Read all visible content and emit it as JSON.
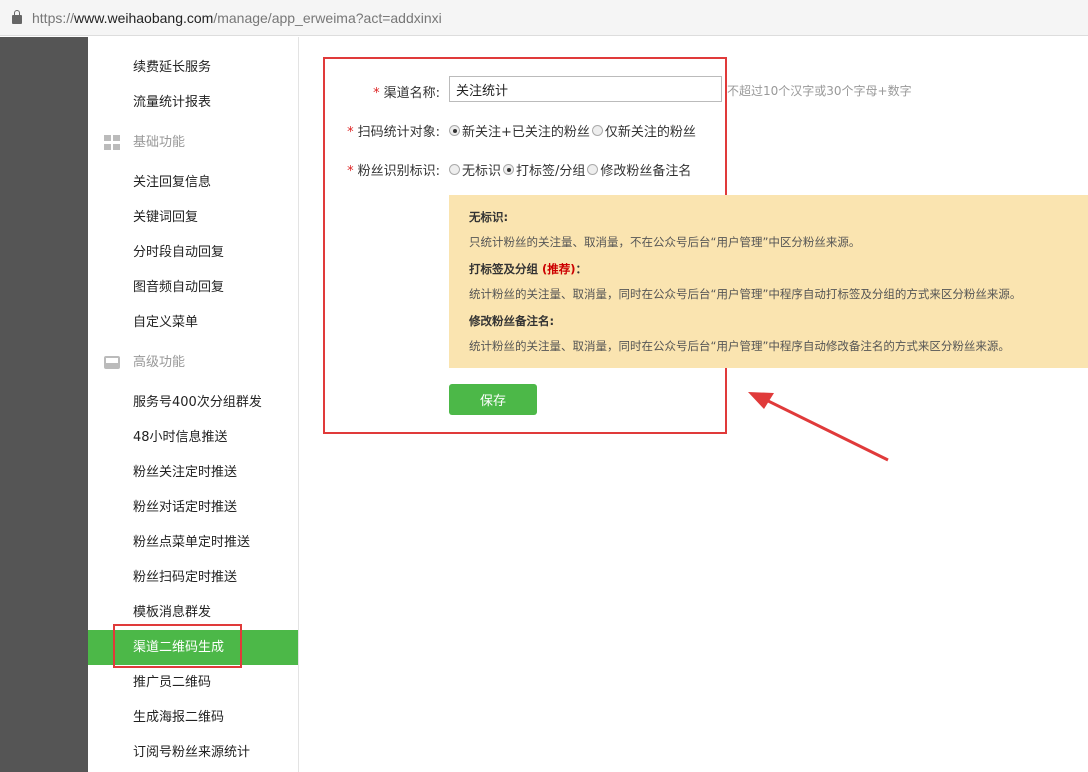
{
  "browser": {
    "url_scheme": "https://",
    "url_host": "www.weihaobang.com",
    "url_path": "/manage/app_erweima?act=addxinxi"
  },
  "sidebar": {
    "items": [
      {
        "label": "续费延长服务",
        "type": "item"
      },
      {
        "label": "流量统计报表",
        "type": "item"
      },
      {
        "label": "基础功能",
        "type": "group",
        "icon": "grid-icon"
      },
      {
        "label": "关注回复信息",
        "type": "item"
      },
      {
        "label": "关键词回复",
        "type": "item"
      },
      {
        "label": "分时段自动回复",
        "type": "item"
      },
      {
        "label": "图音频自动回复",
        "type": "item"
      },
      {
        "label": "自定义菜单",
        "type": "item"
      },
      {
        "label": "高级功能",
        "type": "group",
        "icon": "inbox-icon"
      },
      {
        "label": "服务号400次分组群发",
        "type": "item"
      },
      {
        "label": "48小时信息推送",
        "type": "item"
      },
      {
        "label": "粉丝关注定时推送",
        "type": "item"
      },
      {
        "label": "粉丝对话定时推送",
        "type": "item"
      },
      {
        "label": "粉丝点菜单定时推送",
        "type": "item"
      },
      {
        "label": "粉丝扫码定时推送",
        "type": "item"
      },
      {
        "label": "模板消息群发",
        "type": "item"
      },
      {
        "label": "渠道二维码生成",
        "type": "item",
        "active": true
      },
      {
        "label": "推广员二维码",
        "type": "item"
      },
      {
        "label": "生成海报二维码",
        "type": "item"
      },
      {
        "label": "订阅号粉丝来源统计",
        "type": "item"
      }
    ]
  },
  "form": {
    "required_mark": "*",
    "channel_name": {
      "label": "渠道名称:",
      "value": "关注统计",
      "hint": "不超过10个汉字或30个字母+数字"
    },
    "scan_target": {
      "label": "扫码统计对象:",
      "options": [
        "新关注+已关注的粉丝",
        "仅新关注的粉丝"
      ],
      "selected": 0
    },
    "fan_marker": {
      "label": "粉丝识别标识:",
      "options": [
        "无标识",
        "打标签/分组",
        "修改粉丝备注名"
      ],
      "selected": 1
    },
    "notice": {
      "sections": [
        {
          "title": "无标识:",
          "desc": "只统计粉丝的关注量、取消量，不在公众号后台“用户管理”中区分粉丝来源。"
        },
        {
          "title": "打标签及分组",
          "badge": "(推荐)",
          "title_suffix": "：",
          "desc": "统计粉丝的关注量、取消量，同时在公众号后台“用户管理”中程序自动打标签及分组的方式来区分粉丝来源。"
        },
        {
          "title": "修改粉丝备注名:",
          "desc": "统计粉丝的关注量、取消量，同时在公众号后台“用户管理”中程序自动修改备注名的方式来区分粉丝来源。"
        }
      ]
    },
    "save_label": "保存"
  },
  "colors": {
    "accent": "#4cb848",
    "annotation": "#e03a3a",
    "notice_bg": "#fae4b0"
  }
}
